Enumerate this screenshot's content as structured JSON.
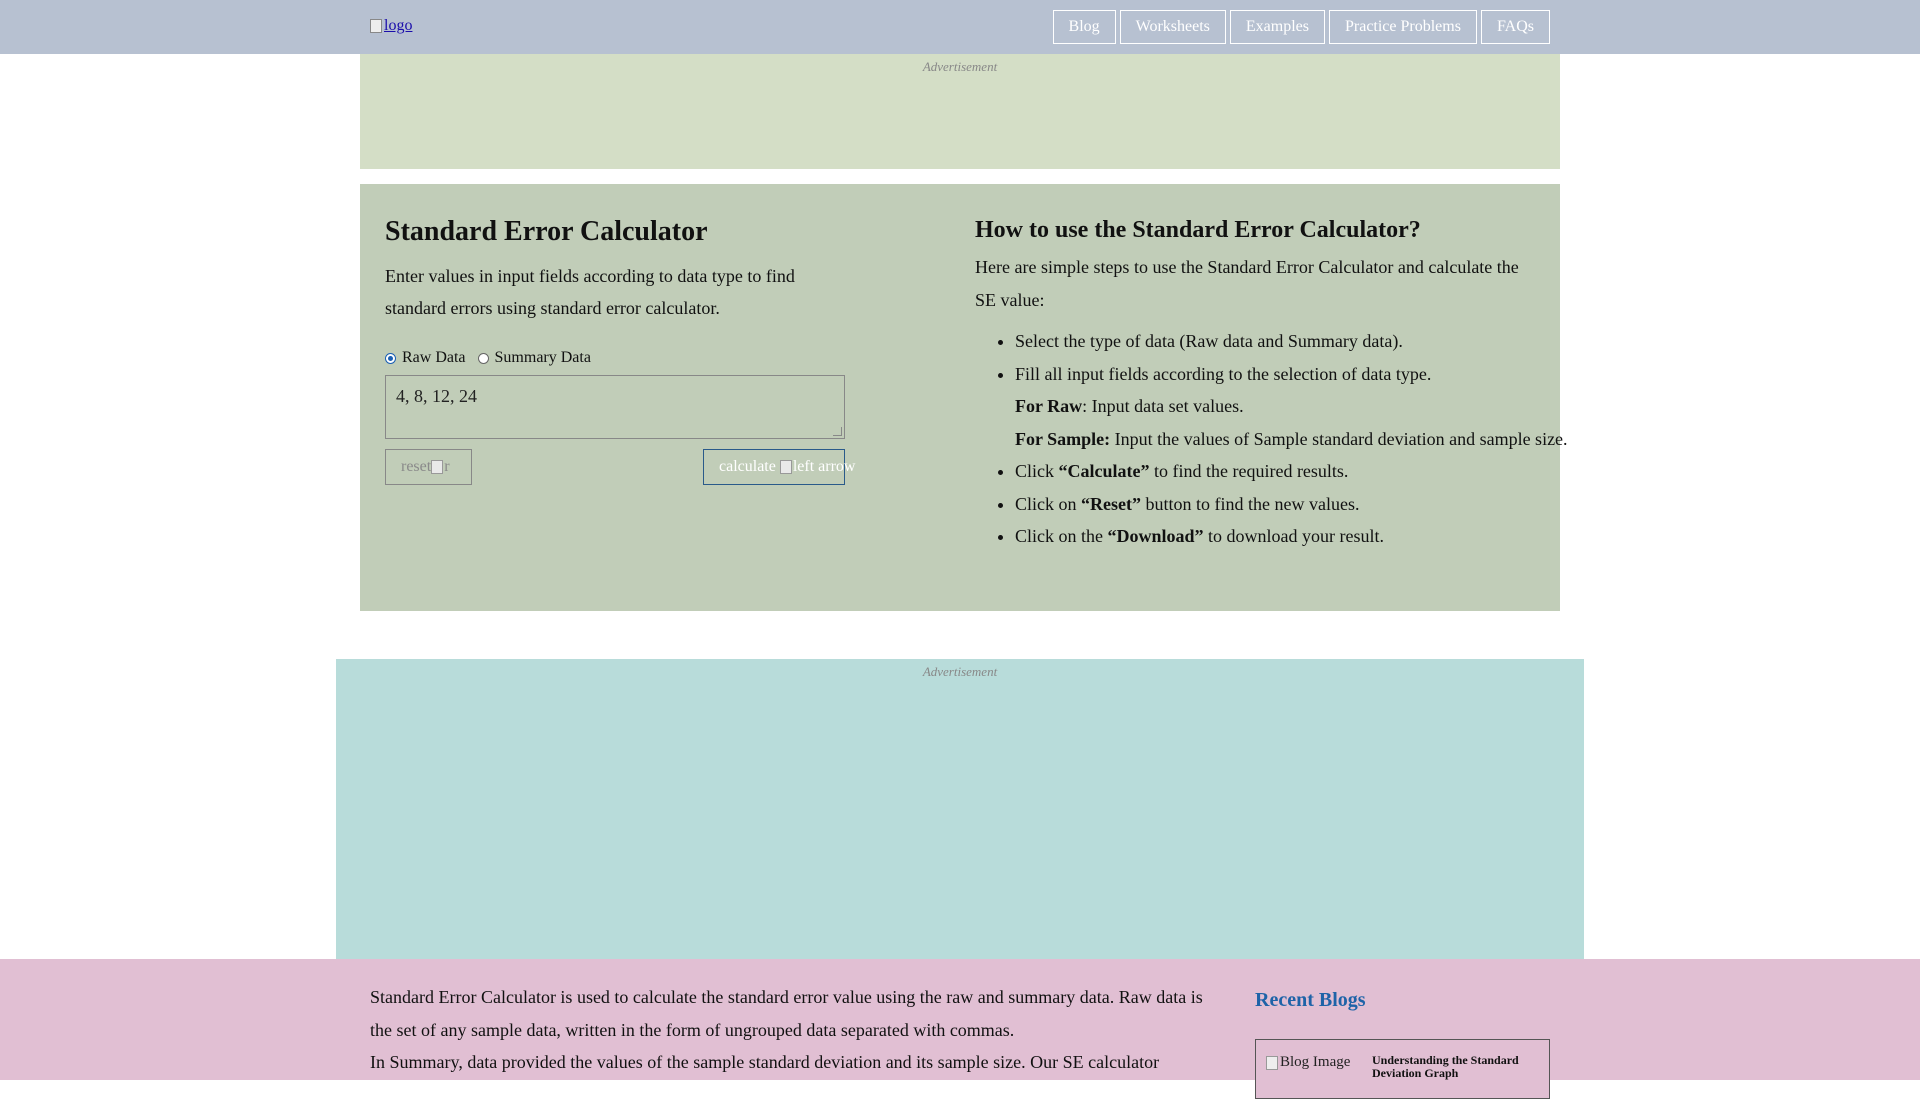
{
  "header": {
    "logo_alt": "logo",
    "nav": [
      "Blog",
      "Worksheets",
      "Examples",
      "Practice Problems",
      "FAQs"
    ]
  },
  "ads": {
    "label": "Advertisement"
  },
  "calculator": {
    "title": "Standard Error Calculator",
    "description": "Enter values in input fields according to data type to find standard errors using standard error calculator.",
    "radio_raw": "Raw Data",
    "radio_summary": "Summary Data",
    "selected": "Raw Data",
    "input_value": "4, 8, 12, 24",
    "reset_label": "reset",
    "reset_icon_alt": "r",
    "calculate_label": "calculate",
    "calculate_icon_alt": "left arrow"
  },
  "howto": {
    "title": "How to use the Standard Error Calculator?",
    "intro": "Here are simple steps to use the Standard Error Calculator and calculate the SE value:",
    "step1": "Select the type of data (Raw data and Summary data).",
    "step2": "Fill all input fields according to the selection of data type.",
    "step2_raw_label": "For Raw",
    "step2_raw_text": ": Input data set values.",
    "step2_sample_label": "For Sample:",
    "step2_sample_text": " Input the values of Sample standard deviation and sample size.",
    "step3_pre": "Click ",
    "step3_bold": "“Calculate”",
    "step3_post": " to find the required results.",
    "step4_pre": "Click on ",
    "step4_bold": "“Reset”",
    "step4_post": " button to find the new values.",
    "step5_pre": "Click on the ",
    "step5_bold": "“Download”",
    "step5_post": " to download your result."
  },
  "content": {
    "para1": "Standard Error Calculator is used to calculate the standard error value using the raw and summary data. Raw data is the set of any sample data, written in the form of ungrouped data separated with commas.",
    "para2": "In Summary, data provided the values of the sample standard deviation and its sample size. Our SE calculator"
  },
  "recent_blogs": {
    "title": "Recent Blogs",
    "items": [
      {
        "image_alt": "Blog Image",
        "title": "Understanding the Standard Deviation Graph"
      }
    ]
  },
  "colors": {
    "header_bg": "#b7c1d1",
    "ad1_bg": "#d4dec6",
    "panel_bg": "#c1cdb8",
    "ad2_bg": "#b8dcda",
    "content_bg": "#e1bfd3",
    "link_blue": "#1e63a8"
  }
}
